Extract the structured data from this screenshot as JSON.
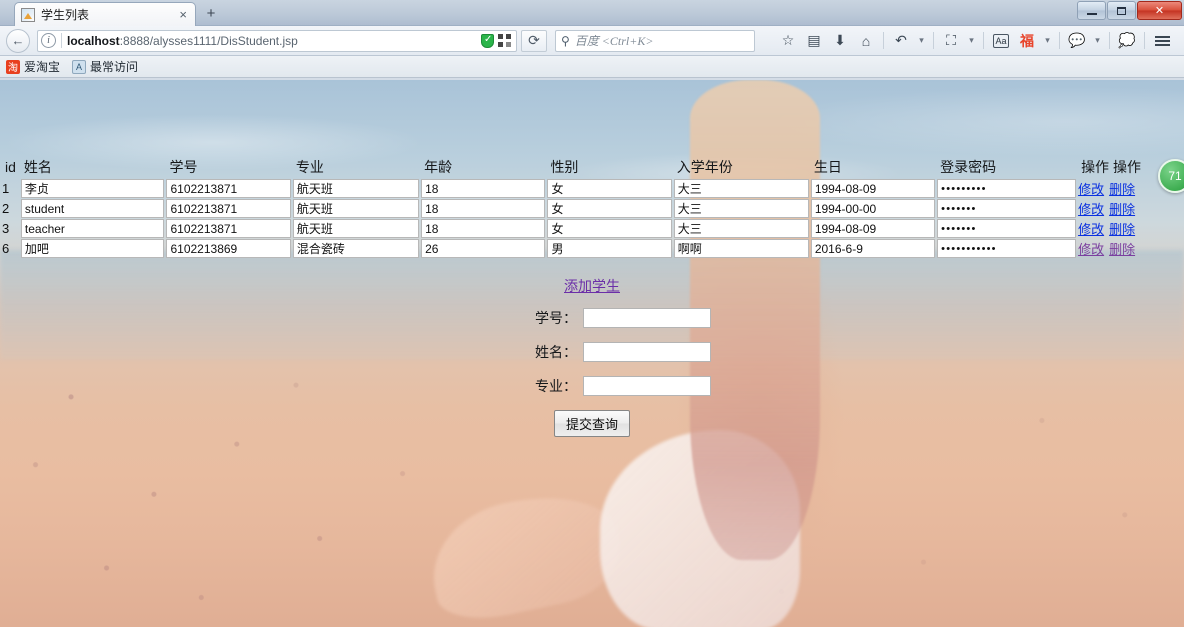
{
  "window": {
    "minimize_label": "–",
    "restore_label": "❐",
    "close_label": "✕"
  },
  "tab": {
    "title": "学生列表",
    "close_label": "×",
    "newtab_label": "+"
  },
  "addressbar": {
    "back_label": "←",
    "info_label": "i",
    "url_host": "localhost",
    "url_rest": ":8888/alysses1111/DisStudent.jsp",
    "reload_label": "⟳",
    "shield_label": "✓"
  },
  "search": {
    "icon_label": "🔍",
    "placeholder": "百度 <Ctrl+K>"
  },
  "toolbar": {
    "bookmark_star": "☆",
    "library": "▤",
    "downloads": "⬇",
    "home": "⌂",
    "undo": "↶",
    "caret1": "▾",
    "crop": "⛶",
    "caret2": "▾",
    "font": "Aa",
    "fu_char": "福",
    "caret3": "▾",
    "chat_bubble": "💬",
    "caret4": "▾",
    "speech": "💭",
    "menu": "≡"
  },
  "bookmarks": [
    {
      "label": "爱淘宝",
      "icon": "taobao-icon",
      "icon_char": "淘"
    },
    {
      "label": "最常访问",
      "icon": "most-visited-icon",
      "icon_char": "A"
    }
  ],
  "table": {
    "headers": {
      "id": "id",
      "name": "姓名",
      "sno": "学号",
      "major": "专业",
      "age": "年龄",
      "sex": "性别",
      "year": "入学年份",
      "birthday": "生日",
      "password": "登录密码",
      "op1": "操作",
      "op2": "操作"
    },
    "ops": {
      "edit": "修改",
      "delete": "删除"
    },
    "rows": [
      {
        "id": "1",
        "name": "李贞",
        "sno": "6102213871",
        "major": "航天班",
        "age": "18",
        "sex": "女",
        "year": "大三",
        "birthday": "1994-08-09",
        "password": "•••••••••",
        "visited": false
      },
      {
        "id": "2",
        "name": "student",
        "sno": "6102213871",
        "major": "航天班",
        "age": "18",
        "sex": "女",
        "year": "大三",
        "birthday": "1994-00-00",
        "password": "•••••••",
        "visited": false
      },
      {
        "id": "3",
        "name": "teacher",
        "sno": "6102213871",
        "major": "航天班",
        "age": "18",
        "sex": "女",
        "year": "大三",
        "birthday": "1994-08-09",
        "password": "•••••••",
        "visited": false
      },
      {
        "id": "6",
        "name": "加吧",
        "sno": "6102213869",
        "major": "混合瓷砖",
        "age": "26",
        "sex": "男",
        "year": "啊啊",
        "birthday": "2016-6-9",
        "password": "•••••••••••",
        "visited": true
      }
    ]
  },
  "add_link": "添加学生",
  "query_form": {
    "sno_label": "学号：",
    "sno_value": "",
    "name_label": "姓名：",
    "name_value": "",
    "major_label": "专业：",
    "major_value": "",
    "submit_label": "提交查询"
  },
  "badge": {
    "text": "71"
  },
  "colors": {
    "link": "#0b31e0",
    "link_visited": "#7a3fa0",
    "badge_green": "#3fae52",
    "close_red": "#c43322"
  }
}
